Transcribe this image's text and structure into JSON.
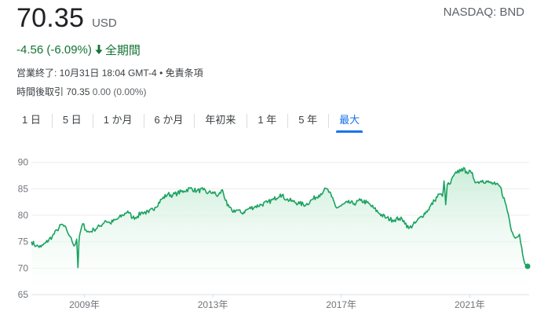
{
  "header": {
    "price": "70.35",
    "currency": "USD",
    "exchange": "NASDAQ: BND",
    "change": "-4.56 (-6.09%)",
    "change_arrow": "down-arrow-icon",
    "period": "全期間",
    "close_info": "営業終了: 10月31日 18:04 GMT-4 • 免責条項",
    "after_hours_label": "時間後取引",
    "after_hours_value": "70.35",
    "after_hours_change": "0.00 (0.00%)"
  },
  "tabs": [
    {
      "label": "1 日",
      "active": false
    },
    {
      "label": "5 日",
      "active": false
    },
    {
      "label": "1 か月",
      "active": false
    },
    {
      "label": "6 か月",
      "active": false
    },
    {
      "label": "年初来",
      "active": false
    },
    {
      "label": "1 年",
      "active": false
    },
    {
      "label": "5 年",
      "active": false
    },
    {
      "label": "最大",
      "active": true
    }
  ],
  "colors": {
    "line": "#1aa260",
    "fill_top": "#c7ecd6",
    "active_tab": "#1a73e8",
    "positive_change": "#137333"
  },
  "chart_data": {
    "type": "area",
    "yticks": [
      90,
      85,
      80,
      75,
      70,
      65
    ],
    "ylim": [
      65,
      91
    ],
    "xlim": [
      2007.35,
      2022.85
    ],
    "xticks": [
      {
        "value": 2009,
        "label": "2009年"
      },
      {
        "value": 2013,
        "label": "2013年"
      },
      {
        "value": 2017,
        "label": "2017年"
      },
      {
        "value": 2021,
        "label": "2021年"
      }
    ],
    "series": [
      {
        "x": [
          2007.35,
          2007.5,
          2007.65,
          2007.8,
          2008.0,
          2008.15,
          2008.3,
          2008.45,
          2008.55,
          2008.62,
          2008.7,
          2008.76,
          2008.8,
          2008.83,
          2008.86,
          2008.95,
          2009.05,
          2009.15,
          2009.3,
          2009.5,
          2009.65,
          2009.8,
          2010.0,
          2010.2,
          2010.35,
          2010.5,
          2010.65,
          2010.8,
          2011.0,
          2011.2,
          2011.4,
          2011.6,
          2011.75,
          2011.9,
          2012.1,
          2012.3,
          2012.5,
          2012.7,
          2012.85,
          2013.0,
          2013.15,
          2013.3,
          2013.45,
          2013.6,
          2013.75,
          2013.9,
          2014.1,
          2014.3,
          2014.5,
          2014.7,
          2014.9,
          2015.1,
          2015.3,
          2015.5,
          2015.7,
          2015.9,
          2016.1,
          2016.3,
          2016.45,
          2016.55,
          2016.7,
          2016.85,
          2017.0,
          2017.2,
          2017.4,
          2017.6,
          2017.8,
          2018.0,
          2018.2,
          2018.4,
          2018.6,
          2018.8,
          2018.95,
          2019.1,
          2019.3,
          2019.5,
          2019.7,
          2019.9,
          2020.05,
          2020.15,
          2020.2,
          2020.25,
          2020.3,
          2020.4,
          2020.5,
          2020.6,
          2020.75,
          2020.9,
          2021.05,
          2021.2,
          2021.4,
          2021.6,
          2021.8,
          2021.95,
          2022.1,
          2022.2,
          2022.3,
          2022.45,
          2022.55,
          2022.65,
          2022.75,
          2022.85
        ],
        "y": [
          75.0,
          74.2,
          74.0,
          74.8,
          76.0,
          77.2,
          78.3,
          77.2,
          76.0,
          75.0,
          74.3,
          75.5,
          70.1,
          74.8,
          76.5,
          78.4,
          77.2,
          76.8,
          77.3,
          78.0,
          79.0,
          78.5,
          79.2,
          80.0,
          80.8,
          79.5,
          79.8,
          80.6,
          80.5,
          81.5,
          83.0,
          84.0,
          83.8,
          84.2,
          84.6,
          85.1,
          84.6,
          84.8,
          84.2,
          84.4,
          83.6,
          84.8,
          81.8,
          80.8,
          81.0,
          80.4,
          81.2,
          81.6,
          82.0,
          82.4,
          83.0,
          84.0,
          83.0,
          82.6,
          82.2,
          82.0,
          83.0,
          83.8,
          84.6,
          85.0,
          83.5,
          81.4,
          81.8,
          82.4,
          82.2,
          82.8,
          82.4,
          81.4,
          80.3,
          79.5,
          79.1,
          79.4,
          79.0,
          77.5,
          78.5,
          79.8,
          81.0,
          82.8,
          84.0,
          83.6,
          86.5,
          82.0,
          85.8,
          86.0,
          87.5,
          88.0,
          88.8,
          88.3,
          88.0,
          86.2,
          86.6,
          86.2,
          85.8,
          85.4,
          82.5,
          80.2,
          77.0,
          75.8,
          76.4,
          72.5,
          70.6,
          70.35
        ]
      }
    ]
  }
}
